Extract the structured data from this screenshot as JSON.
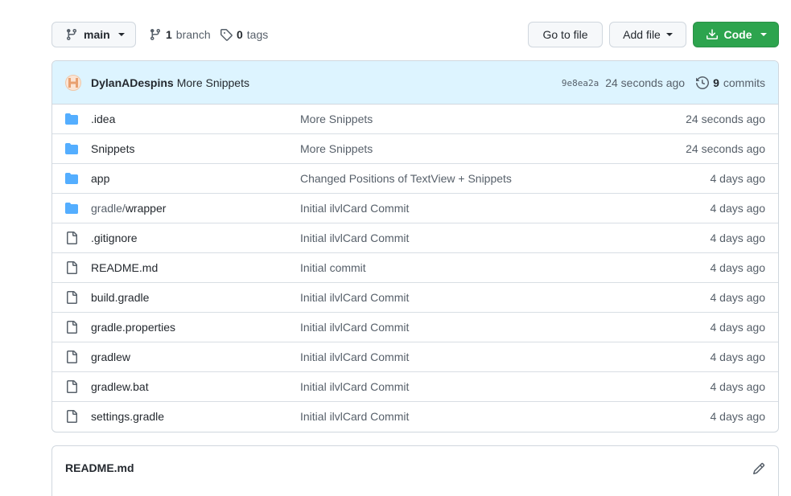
{
  "toolbar": {
    "branch_label": "main",
    "branches_count": "1",
    "branches_label": "branch",
    "tags_count": "0",
    "tags_label": "tags",
    "goto_label": "Go to file",
    "addfile_label": "Add file",
    "code_label": "Code"
  },
  "commit": {
    "author": "DylanADespins",
    "message": "More Snippets",
    "sha": "9e8ea2a",
    "age": "24 seconds ago",
    "commits_count": "9",
    "commits_label": "commits"
  },
  "files": [
    {
      "type": "folder",
      "name": ".idea",
      "name_dim": "",
      "message": "More Snippets",
      "age": "24 seconds ago"
    },
    {
      "type": "folder",
      "name": "Snippets",
      "name_dim": "",
      "message": "More Snippets",
      "age": "24 seconds ago"
    },
    {
      "type": "folder",
      "name": "app",
      "name_dim": "",
      "message": "Changed Positions of TextView + Snippets",
      "age": "4 days ago"
    },
    {
      "type": "folder",
      "name": "wrapper",
      "name_dim": "gradle/",
      "message": "Initial ilvlCard Commit",
      "age": "4 days ago"
    },
    {
      "type": "file",
      "name": ".gitignore",
      "name_dim": "",
      "message": "Initial ilvlCard Commit",
      "age": "4 days ago"
    },
    {
      "type": "file",
      "name": "README.md",
      "name_dim": "",
      "message": "Initial commit",
      "age": "4 days ago"
    },
    {
      "type": "file",
      "name": "build.gradle",
      "name_dim": "",
      "message": "Initial ilvlCard Commit",
      "age": "4 days ago"
    },
    {
      "type": "file",
      "name": "gradle.properties",
      "name_dim": "",
      "message": "Initial ilvlCard Commit",
      "age": "4 days ago"
    },
    {
      "type": "file",
      "name": "gradlew",
      "name_dim": "",
      "message": "Initial ilvlCard Commit",
      "age": "4 days ago"
    },
    {
      "type": "file",
      "name": "gradlew.bat",
      "name_dim": "",
      "message": "Initial ilvlCard Commit",
      "age": "4 days ago"
    },
    {
      "type": "file",
      "name": "settings.gradle",
      "name_dim": "",
      "message": "Initial ilvlCard Commit",
      "age": "4 days ago"
    }
  ],
  "readme": {
    "title": "README.md"
  },
  "icons": {
    "folder": "folder-icon",
    "file": "file-icon",
    "branch": "git-branch-icon",
    "tag": "tag-icon",
    "history": "history-icon",
    "download": "download-icon",
    "pencil": "pencil-icon"
  },
  "colors": {
    "folder": "#54aeff",
    "code_button": "#2da44e",
    "commit_bar": "#ddf4ff",
    "border": "#d0d7de",
    "muted_text": "#57606a"
  }
}
